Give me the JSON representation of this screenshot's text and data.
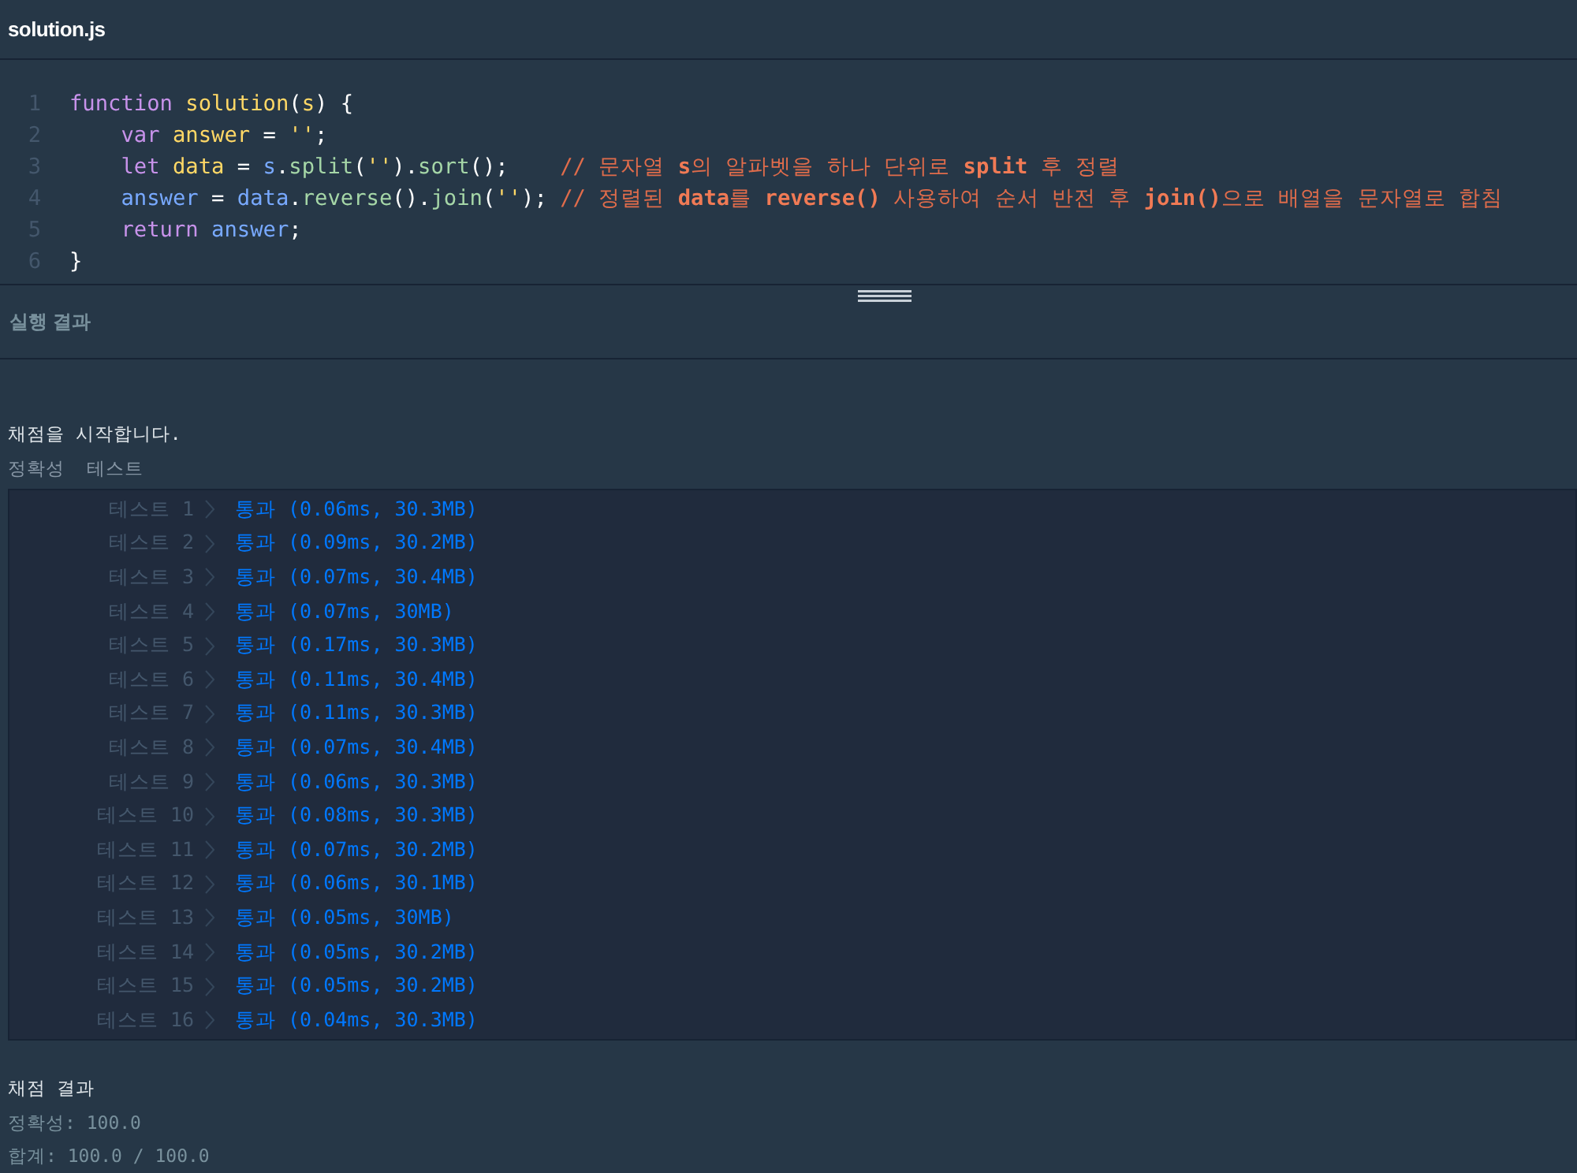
{
  "file_title": "solution.js",
  "code_lines": [
    {
      "number": "1",
      "tokens": [
        {
          "kind": "keyword",
          "text": "function "
        },
        {
          "kind": "name",
          "text": "solution"
        },
        {
          "kind": "plain",
          "text": "("
        },
        {
          "kind": "name",
          "text": "s"
        },
        {
          "kind": "plain",
          "text": ") {"
        }
      ]
    },
    {
      "number": "2",
      "indented": true,
      "tokens": [
        {
          "kind": "keyword",
          "text": "var "
        },
        {
          "kind": "name",
          "text": "answer"
        },
        {
          "kind": "plain",
          "text": " = "
        },
        {
          "kind": "string",
          "text": "''"
        },
        {
          "kind": "plain",
          "text": ";"
        }
      ]
    },
    {
      "number": "3",
      "indented": true,
      "tokens": [
        {
          "kind": "keyword",
          "text": "let "
        },
        {
          "kind": "name",
          "text": "data"
        },
        {
          "kind": "plain",
          "text": " = "
        },
        {
          "kind": "variable",
          "text": "s"
        },
        {
          "kind": "plain",
          "text": "."
        },
        {
          "kind": "method",
          "text": "split"
        },
        {
          "kind": "plain",
          "text": "("
        },
        {
          "kind": "string",
          "text": "''"
        },
        {
          "kind": "plain",
          "text": ")."
        },
        {
          "kind": "method",
          "text": "sort"
        },
        {
          "kind": "plain",
          "text": "();    "
        },
        {
          "kind": "comment",
          "text": "// 문자열 **s**의 알파벳을 하나 단위로 **split** 후 정렬"
        }
      ]
    },
    {
      "number": "4",
      "indented": true,
      "tokens": [
        {
          "kind": "variable",
          "text": "answer"
        },
        {
          "kind": "plain",
          "text": " = "
        },
        {
          "kind": "variable",
          "text": "data"
        },
        {
          "kind": "plain",
          "text": "."
        },
        {
          "kind": "method",
          "text": "reverse"
        },
        {
          "kind": "plain",
          "text": "()."
        },
        {
          "kind": "method",
          "text": "join"
        },
        {
          "kind": "plain",
          "text": "("
        },
        {
          "kind": "string",
          "text": "''"
        },
        {
          "kind": "plain",
          "text": "); "
        },
        {
          "kind": "comment",
          "text": "// 정렬된 **data**를 **reverse()** 사용하여 순서 반전 후 **join()**으로 배열을 문자열로 합침"
        }
      ]
    },
    {
      "number": "5",
      "indented": true,
      "tokens": [
        {
          "kind": "keyword",
          "text": "return "
        },
        {
          "kind": "variable",
          "text": "answer"
        },
        {
          "kind": "plain",
          "text": ";"
        }
      ]
    },
    {
      "number": "6",
      "tokens": [
        {
          "kind": "plain",
          "text": "}"
        }
      ]
    }
  ],
  "result_title": "실행 결과",
  "start_message": "채점을 시작합니다.",
  "test_group_title": "정확성  테스트",
  "tests": [
    {
      "label": "테스트 1",
      "result": "통과 (0.06ms, 30.3MB)"
    },
    {
      "label": "테스트 2",
      "result": "통과 (0.09ms, 30.2MB)"
    },
    {
      "label": "테스트 3",
      "result": "통과 (0.07ms, 30.4MB)"
    },
    {
      "label": "테스트 4",
      "result": "통과 (0.07ms, 30MB)"
    },
    {
      "label": "테스트 5",
      "result": "통과 (0.17ms, 30.3MB)"
    },
    {
      "label": "테스트 6",
      "result": "통과 (0.11ms, 30.4MB)"
    },
    {
      "label": "테스트 7",
      "result": "통과 (0.11ms, 30.3MB)"
    },
    {
      "label": "테스트 8",
      "result": "통과 (0.07ms, 30.4MB)"
    },
    {
      "label": "테스트 9",
      "result": "통과 (0.06ms, 30.3MB)"
    },
    {
      "label": "테스트 10",
      "result": "통과 (0.08ms, 30.3MB)"
    },
    {
      "label": "테스트 11",
      "result": "통과 (0.07ms, 30.2MB)"
    },
    {
      "label": "테스트 12",
      "result": "통과 (0.06ms, 30.1MB)"
    },
    {
      "label": "테스트 13",
      "result": "통과 (0.05ms, 30MB)"
    },
    {
      "label": "테스트 14",
      "result": "통과 (0.05ms, 30.2MB)"
    },
    {
      "label": "테스트 15",
      "result": "통과 (0.05ms, 30.2MB)"
    },
    {
      "label": "테스트 16",
      "result": "통과 (0.04ms, 30.3MB)"
    }
  ],
  "score_title": "채점 결과",
  "accuracy": "정확성: 100.0",
  "total": "합계: 100.0 / 100.0"
}
